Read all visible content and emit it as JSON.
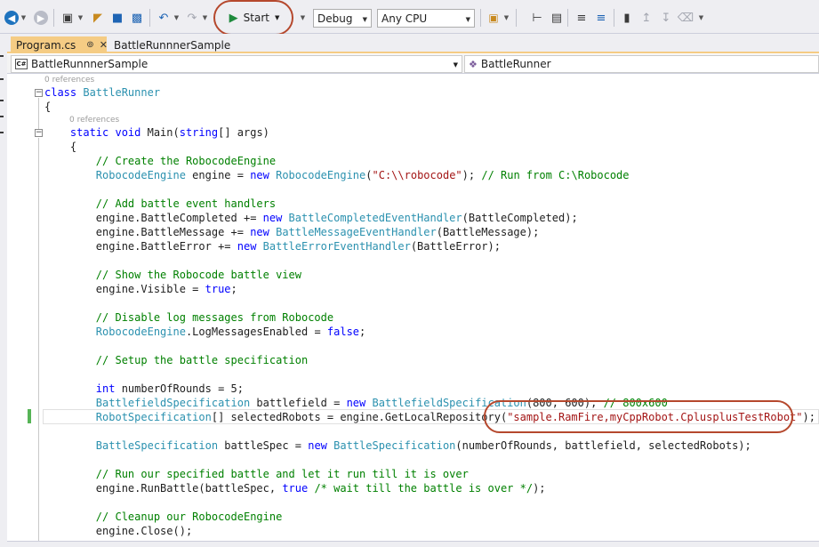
{
  "toolbar": {
    "start_label": "Start",
    "configuration": "Debug",
    "platform": "Any CPU",
    "icons": [
      "back-icon",
      "forward-icon",
      "new-project-icon",
      "open-file-icon",
      "save-icon",
      "save-all-icon",
      "undo-icon",
      "redo-icon",
      "find-icon",
      "comment-icon",
      "bookmark-icon"
    ]
  },
  "tabs": [
    {
      "label": "Program.cs",
      "active": true
    },
    {
      "label": "BattleRunnnerSample",
      "active": false
    }
  ],
  "navbar": {
    "project": "BattleRunnnerSample",
    "project_badge": "C#",
    "class": "BattleRunner"
  },
  "editor": {
    "references_1": "0 references",
    "references_2": "0 references",
    "lines": [
      [
        {
          "t": "class ",
          "c": "kw"
        },
        {
          "t": "BattleRunner",
          "c": "ty"
        }
      ],
      [
        {
          "t": "{",
          "c": "tx"
        }
      ],
      [
        {
          "t": "    static ",
          "c": "kw"
        },
        {
          "t": "void ",
          "c": "kw"
        },
        {
          "t": "Main(",
          "c": "tx"
        },
        {
          "t": "string",
          "c": "kw"
        },
        {
          "t": "[] args)",
          "c": "tx"
        }
      ],
      [
        {
          "t": "    {",
          "c": "tx"
        }
      ],
      [
        {
          "t": "        // Create the RobocodeEngine",
          "c": "cm"
        }
      ],
      [
        {
          "t": "        RobocodeEngine",
          "c": "ty"
        },
        {
          "t": " engine = ",
          "c": "tx"
        },
        {
          "t": "new ",
          "c": "kw"
        },
        {
          "t": "RobocodeEngine",
          "c": "ty"
        },
        {
          "t": "(",
          "c": "tx"
        },
        {
          "t": "\"C:\\\\robocode\"",
          "c": "str"
        },
        {
          "t": "); ",
          "c": "tx"
        },
        {
          "t": "// Run from C:\\Robocode",
          "c": "cm"
        }
      ],
      [],
      [
        {
          "t": "        // Add battle event handlers",
          "c": "cm"
        }
      ],
      [
        {
          "t": "        engine.BattleCompleted += ",
          "c": "tx"
        },
        {
          "t": "new ",
          "c": "kw"
        },
        {
          "t": "BattleCompletedEventHandler",
          "c": "ty"
        },
        {
          "t": "(BattleCompleted);",
          "c": "tx"
        }
      ],
      [
        {
          "t": "        engine.BattleMessage += ",
          "c": "tx"
        },
        {
          "t": "new ",
          "c": "kw"
        },
        {
          "t": "BattleMessageEventHandler",
          "c": "ty"
        },
        {
          "t": "(BattleMessage);",
          "c": "tx"
        }
      ],
      [
        {
          "t": "        engine.BattleError += ",
          "c": "tx"
        },
        {
          "t": "new ",
          "c": "kw"
        },
        {
          "t": "BattleErrorEventHandler",
          "c": "ty"
        },
        {
          "t": "(BattleError);",
          "c": "tx"
        }
      ],
      [],
      [
        {
          "t": "        // Show the Robocode battle view",
          "c": "cm"
        }
      ],
      [
        {
          "t": "        engine.Visible = ",
          "c": "tx"
        },
        {
          "t": "true",
          "c": "kw"
        },
        {
          "t": ";",
          "c": "tx"
        }
      ],
      [],
      [
        {
          "t": "        // Disable log messages from Robocode",
          "c": "cm"
        }
      ],
      [
        {
          "t": "        RobocodeEngine",
          "c": "ty"
        },
        {
          "t": ".LogMessagesEnabled = ",
          "c": "tx"
        },
        {
          "t": "false",
          "c": "kw"
        },
        {
          "t": ";",
          "c": "tx"
        }
      ],
      [],
      [
        {
          "t": "        // Setup the battle specification",
          "c": "cm"
        }
      ],
      [],
      [
        {
          "t": "        int ",
          "c": "kw"
        },
        {
          "t": "numberOfRounds = 5;",
          "c": "tx"
        }
      ],
      [
        {
          "t": "        BattlefieldSpecification",
          "c": "ty"
        },
        {
          "t": " battlefield = ",
          "c": "tx"
        },
        {
          "t": "new ",
          "c": "kw"
        },
        {
          "t": "BattlefieldSpecification",
          "c": "ty"
        },
        {
          "t": "(800, 600); ",
          "c": "tx"
        },
        {
          "t": "// 800x600",
          "c": "cm"
        }
      ],
      [
        {
          "t": "        RobotSpecification",
          "c": "ty"
        },
        {
          "t": "[] selectedRobots = engine.GetLocalRepository(",
          "c": "tx"
        },
        {
          "t": "\"sample.RamFire,myCppRobot.CplusplusTestRobot\"",
          "c": "str"
        },
        {
          "t": ");",
          "c": "tx"
        }
      ],
      [],
      [
        {
          "t": "        BattleSpecification",
          "c": "ty"
        },
        {
          "t": " battleSpec = ",
          "c": "tx"
        },
        {
          "t": "new ",
          "c": "kw"
        },
        {
          "t": "BattleSpecification",
          "c": "ty"
        },
        {
          "t": "(numberOfRounds, battlefield, selectedRobots);",
          "c": "tx"
        }
      ],
      [],
      [
        {
          "t": "        // Run our specified battle and let it run till it is over",
          "c": "cm"
        }
      ],
      [
        {
          "t": "        engine.RunBattle(battleSpec, ",
          "c": "tx"
        },
        {
          "t": "true ",
          "c": "kw"
        },
        {
          "t": "/* wait till the battle is over */",
          "c": "cm"
        },
        {
          "t": ");",
          "c": "tx"
        }
      ],
      [],
      [
        {
          "t": "        // Cleanup our RobocodeEngine",
          "c": "cm"
        }
      ],
      [
        {
          "t": "        engine.Close();",
          "c": "tx"
        }
      ]
    ]
  }
}
